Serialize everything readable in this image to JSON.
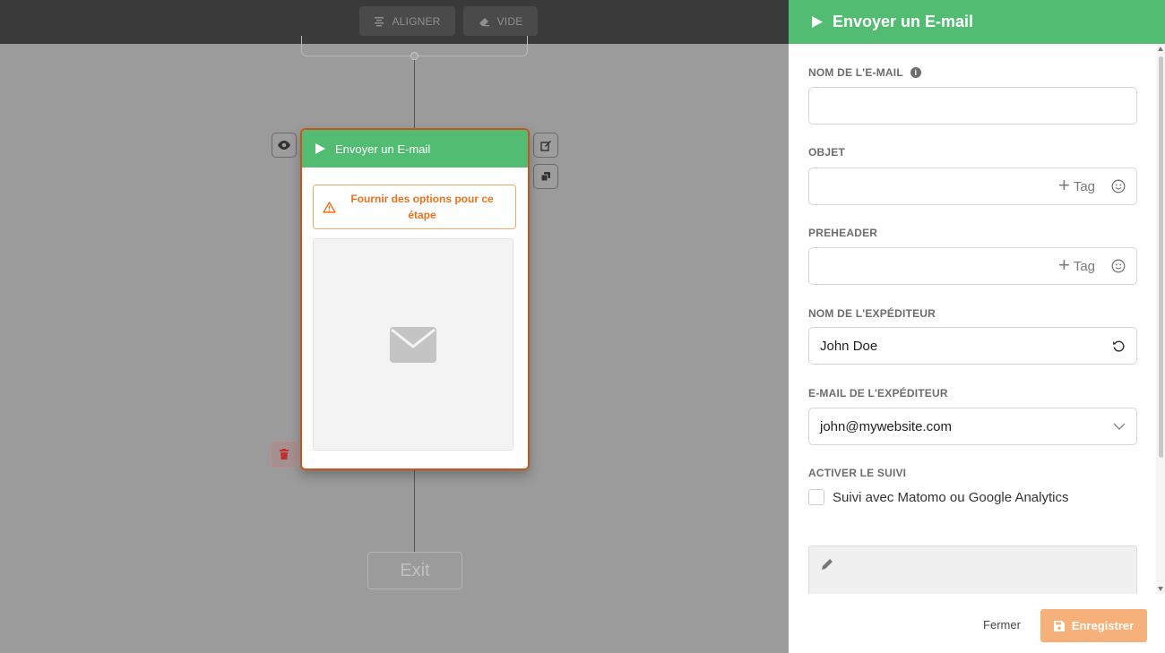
{
  "toolbar": {
    "align_label": "ALIGNER",
    "clear_label": "VIDE"
  },
  "node": {
    "title": "Envoyer un E-mail",
    "warning": "Fournir des options pour ce étape",
    "image_icon": "envelope-icon"
  },
  "exit_node": {
    "label": "Exit"
  },
  "panel": {
    "title": "Envoyer un E-mail",
    "fields": {
      "email_name": {
        "label": "NOM DE L'E-MAIL",
        "value": ""
      },
      "subject": {
        "label": "OBJET",
        "value": "",
        "tag_label": "Tag"
      },
      "preheader": {
        "label": "PREHEADER",
        "value": "",
        "tag_label": "Tag"
      },
      "sender_name": {
        "label": "NOM DE L'EXPÉDITEUR",
        "value": "John Doe"
      },
      "sender_email": {
        "label": "E-MAIL DE L'EXPÉDITEUR",
        "value": "john@mywebsite.com"
      },
      "tracking": {
        "label": "ACTIVER LE SUIVI",
        "checkbox_label": "Suivi avec Matomo ou Google Analytics",
        "checked": false
      }
    },
    "footer": {
      "close_label": "Fermer",
      "save_label": "Enregistrer"
    }
  },
  "colors": {
    "header_green": "#52bc73",
    "node_border": "#c8561a",
    "warning_orange": "#e8731d",
    "save_button": "#f6b17a"
  }
}
